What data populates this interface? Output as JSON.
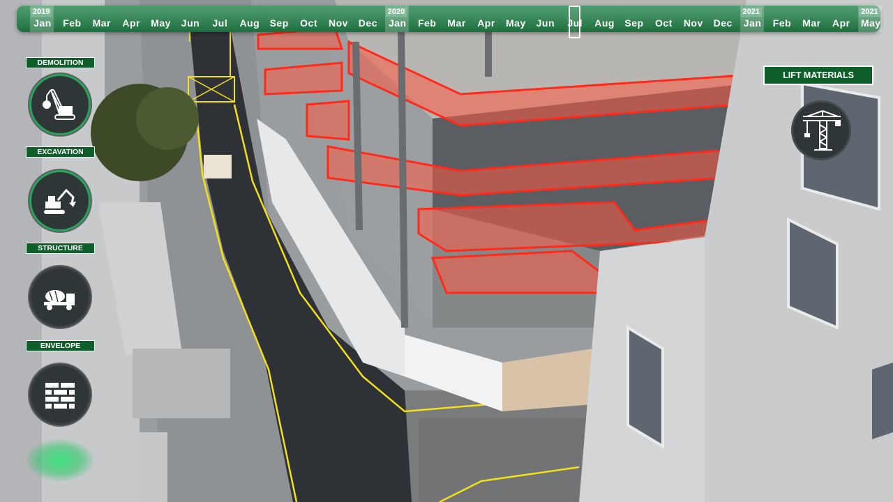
{
  "timeline": {
    "years": [
      {
        "label": "2019",
        "month_index": 0
      },
      {
        "label": "2020",
        "month_index": 12
      },
      {
        "label": "2021",
        "month_index": 24
      },
      {
        "label": "2021",
        "month_index": 28
      }
    ],
    "months": [
      "Jan",
      "Feb",
      "Mar",
      "Apr",
      "May",
      "Jun",
      "Jul",
      "Aug",
      "Sep",
      "Oct",
      "Nov",
      "Dec",
      "Jan",
      "Feb",
      "Mar",
      "Apr",
      "May",
      "Jun",
      "Jul",
      "Aug",
      "Sep",
      "Oct",
      "Nov",
      "Dec",
      "Jan",
      "Feb",
      "Mar",
      "Apr",
      "May"
    ],
    "current_month_index": 18
  },
  "phases": {
    "demolition": {
      "label": "DEMOLITION",
      "icon": "crane-wrecking-ball-icon"
    },
    "excavation": {
      "label": "EXCAVATION",
      "icon": "excavator-icon"
    },
    "structure": {
      "label": "STRUCTURE",
      "icon": "concrete-mixer-truck-icon"
    },
    "envelope": {
      "label": "ENVELOPE",
      "icon": "brick-wall-icon"
    }
  },
  "lift": {
    "label": "LIFT MATERIALS",
    "icon": "tower-crane-icon"
  },
  "colors": {
    "accent": "#0f5f2b",
    "timeline_green": "#3f8d60",
    "safety_red": "#ff3a2a",
    "road_line": "#f2e11a"
  }
}
